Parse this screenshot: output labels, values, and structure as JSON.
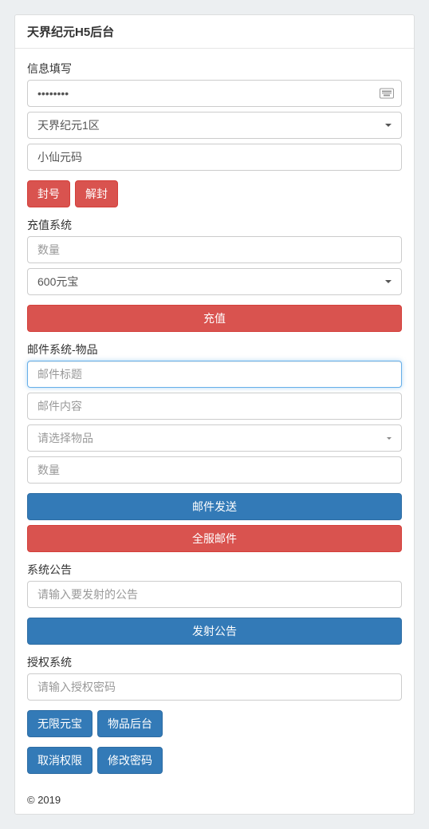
{
  "panel": {
    "title": "天界纪元H5后台"
  },
  "info": {
    "label": "信息填写",
    "password_value": "••••••••",
    "server_select": "天界纪元1区",
    "name_value": "小仙元码",
    "ban_btn": "封号",
    "unban_btn": "解封"
  },
  "recharge": {
    "label": "充值系统",
    "qty_placeholder": "数量",
    "amount_select": "600元宝",
    "submit_btn": "充值"
  },
  "mail": {
    "label": "邮件系统-物品",
    "title_placeholder": "邮件标题",
    "content_placeholder": "邮件内容",
    "item_select_placeholder": "请选择物品",
    "qty_placeholder": "数量",
    "send_btn": "邮件发送",
    "all_btn": "全服邮件"
  },
  "notice": {
    "label": "系统公告",
    "placeholder": "请输入要发射的公告",
    "send_btn": "发射公告"
  },
  "auth": {
    "label": "授权系统",
    "placeholder": "请输入授权密码",
    "unlimited_btn": "无限元宝",
    "item_admin_btn": "物品后台",
    "cancel_btn": "取消权限",
    "change_pwd_btn": "修改密码"
  },
  "footer": {
    "text": "© 2019"
  }
}
